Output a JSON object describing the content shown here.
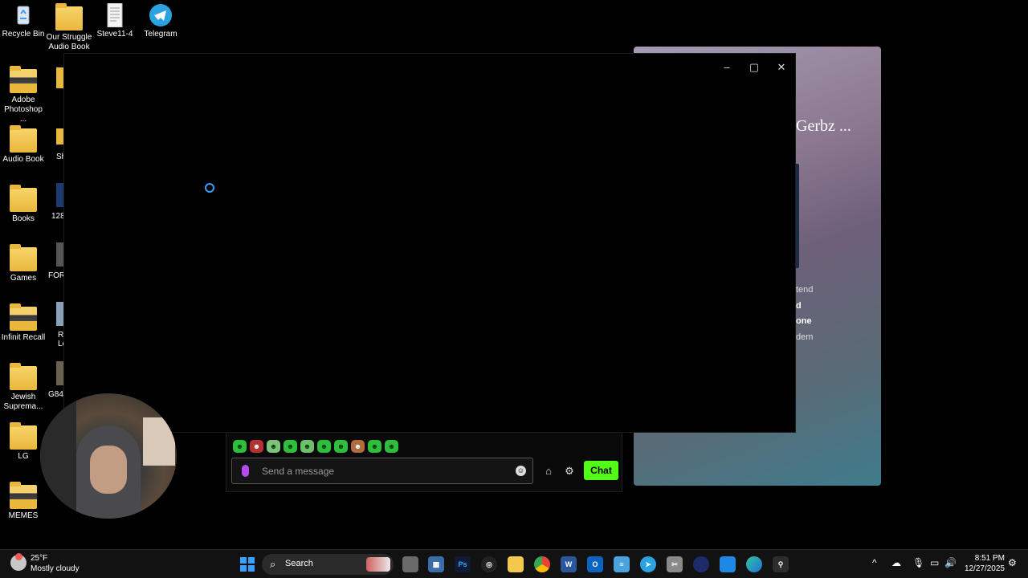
{
  "desktop": {
    "icons": [
      {
        "label": "Recycle Bin",
        "icon": "recycle-bin-icon"
      },
      {
        "label": "Our Struggle Audio Book",
        "icon": "folder-icon"
      },
      {
        "label": "Steve11-4",
        "icon": "document-icon"
      },
      {
        "label": "Telegram",
        "icon": "telegram-icon"
      },
      {
        "label": "Adobe Photoshop ...",
        "icon": "folder-icon"
      },
      {
        "label": "Audio Book",
        "icon": "folder-icon"
      },
      {
        "label": "Books",
        "icon": "folder-icon"
      },
      {
        "label": "Games",
        "icon": "folder-icon"
      },
      {
        "label": "Infinit Recall",
        "icon": "folder-icon"
      },
      {
        "label": "Jewish Suprema...",
        "icon": "folder-icon"
      },
      {
        "label": "LG",
        "icon": "folder-icon"
      },
      {
        "label": "MEMES",
        "icon": "folder-icon"
      }
    ],
    "partial_labels": [
      "Sh",
      "128",
      "FOR",
      "Re Le",
      "G84g"
    ]
  },
  "background_window": {
    "title": "Gerbz ...",
    "lines": [
      "tend",
      "d",
      "one",
      "dem"
    ]
  },
  "main_window": {
    "controls": {
      "minimize": "–",
      "maximize": "▢",
      "close": "✕"
    }
  },
  "chat": {
    "emotes": [
      "emote-1",
      "emote-2",
      "emote-3",
      "emote-4",
      "emote-5",
      "emote-6",
      "emote-7",
      "emote-8",
      "emote-9",
      "emote-10"
    ],
    "placeholder": "Send a message",
    "send_label": "Chat",
    "accent": "#53fc18"
  },
  "taskbar": {
    "temperature": "25°F",
    "condition": "Mostly cloudy",
    "search_label": "Search",
    "time": "8:51 PM",
    "date": "12/27/2025"
  }
}
